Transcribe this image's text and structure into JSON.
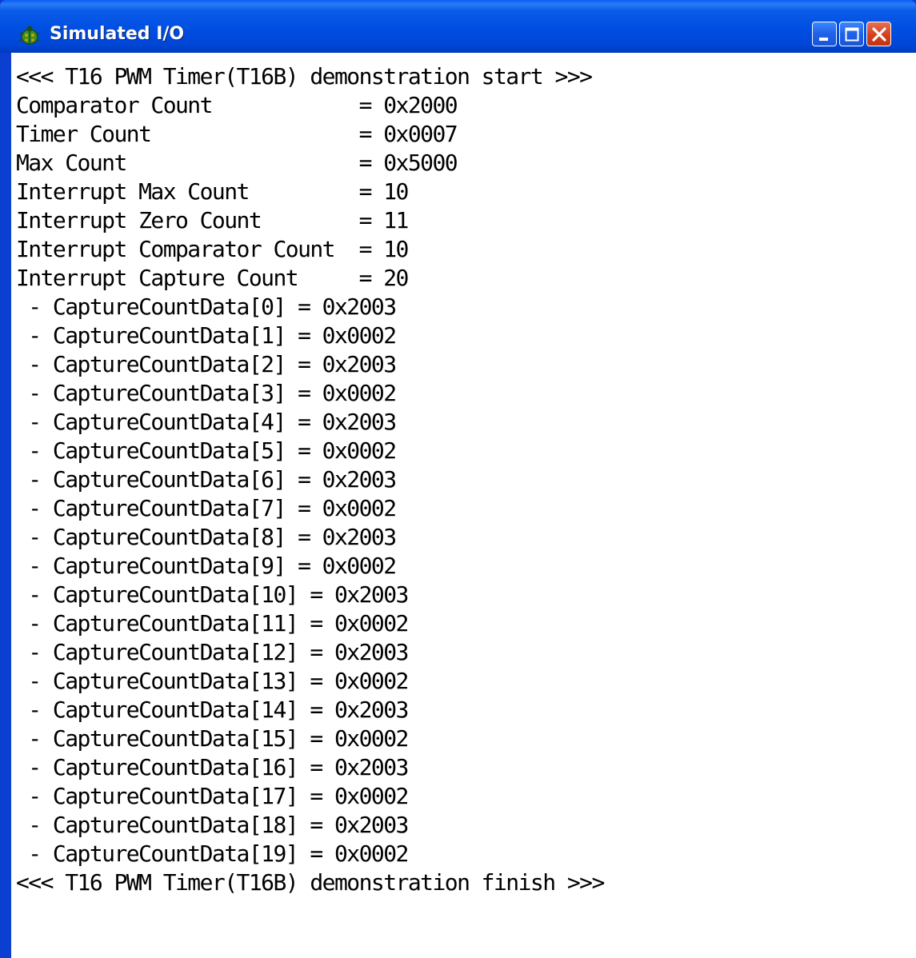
{
  "window": {
    "title": "Simulated I/O",
    "icon": "ladybug-icon",
    "controls": [
      "minimize-icon",
      "maximize-icon",
      "close-icon"
    ]
  },
  "colors": {
    "titlebar": "#0054e3",
    "frame": "#0a3fd0",
    "close_button": "#d43f1e",
    "console_background": "#ffffff",
    "console_text": "#000000"
  },
  "console": {
    "lines": [
      "<<< T16 PWM Timer(T16B) demonstration start >>>",
      "Comparator Count            = 0x2000",
      "Timer Count                 = 0x0007",
      "Max Count                   = 0x5000",
      "Interrupt Max Count         = 10",
      "Interrupt Zero Count        = 11",
      "Interrupt Comparator Count  = 10",
      "Interrupt Capture Count     = 20",
      " - CaptureCountData[0] = 0x2003",
      " - CaptureCountData[1] = 0x0002",
      " - CaptureCountData[2] = 0x2003",
      " - CaptureCountData[3] = 0x0002",
      " - CaptureCountData[4] = 0x2003",
      " - CaptureCountData[5] = 0x0002",
      " - CaptureCountData[6] = 0x2003",
      " - CaptureCountData[7] = 0x0002",
      " - CaptureCountData[8] = 0x2003",
      " - CaptureCountData[9] = 0x0002",
      " - CaptureCountData[10] = 0x2003",
      " - CaptureCountData[11] = 0x0002",
      " - CaptureCountData[12] = 0x2003",
      " - CaptureCountData[13] = 0x0002",
      " - CaptureCountData[14] = 0x2003",
      " - CaptureCountData[15] = 0x0002",
      " - CaptureCountData[16] = 0x2003",
      " - CaptureCountData[17] = 0x0002",
      " - CaptureCountData[18] = 0x2003",
      " - CaptureCountData[19] = 0x0002",
      "<<< T16 PWM Timer(T16B) demonstration finish >>>"
    ]
  }
}
